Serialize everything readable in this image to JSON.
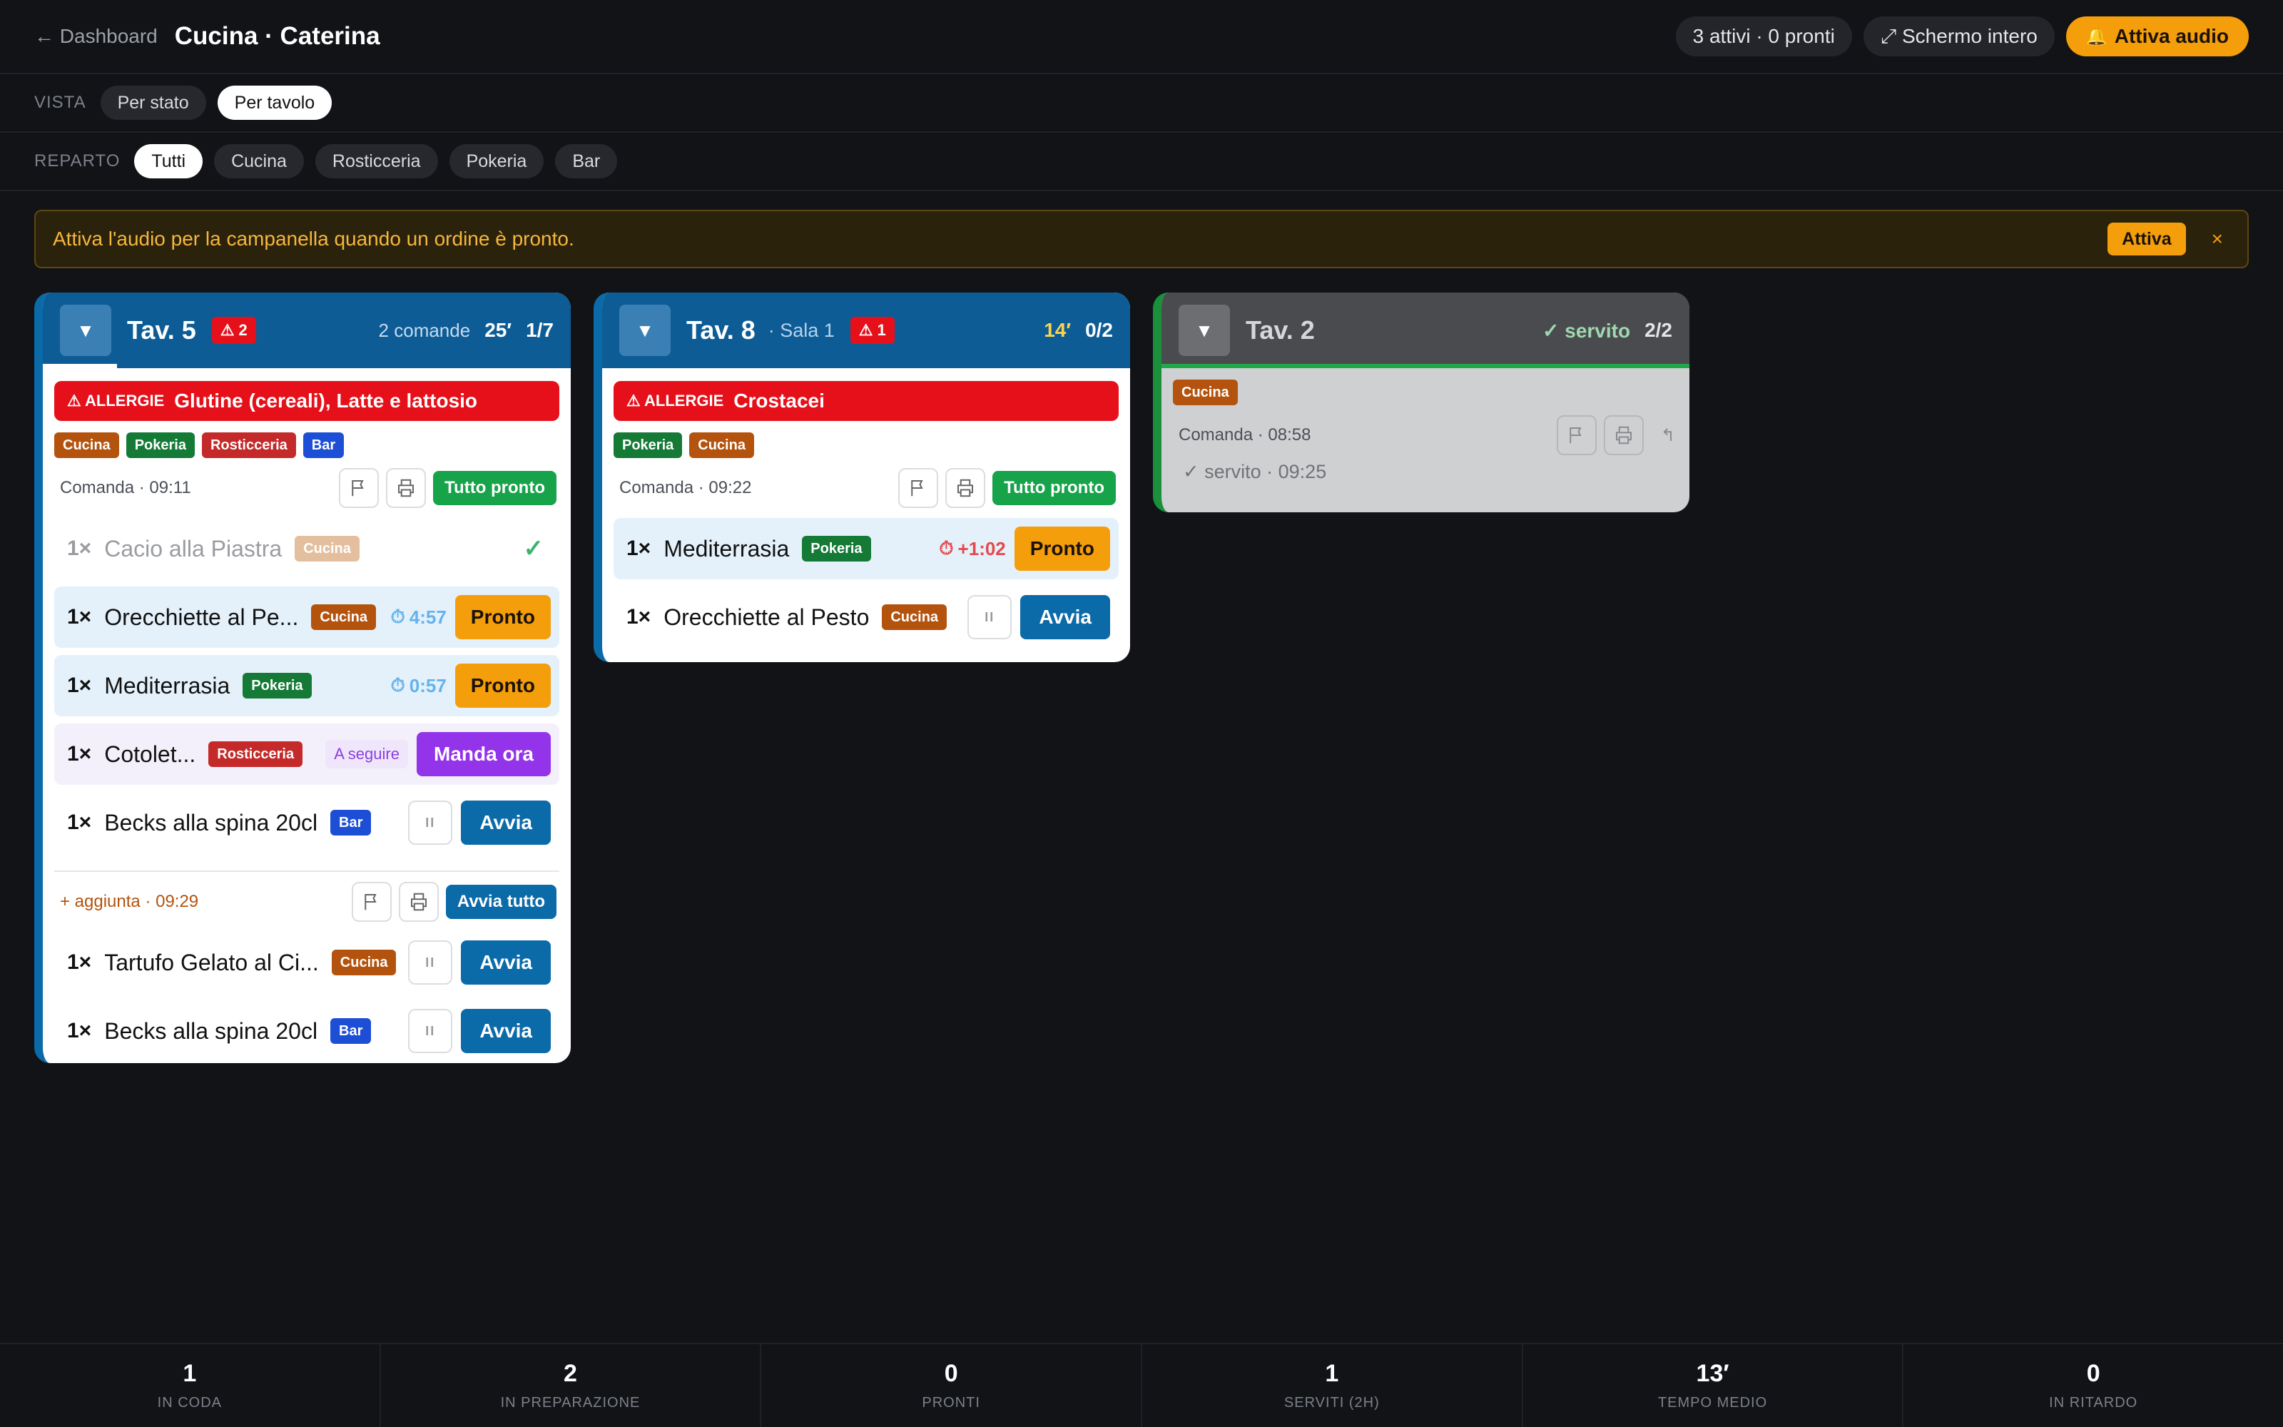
{
  "header": {
    "back": "← Dashboard",
    "title": "Cucina · Caterina",
    "status": "3 attivi · 0 pronti",
    "fullscreen": "⤢ Schermo intero",
    "audio": "Attiva audio"
  },
  "filters": {
    "vista_label": "VISTA",
    "vista": [
      "Per stato",
      "Per tavolo"
    ],
    "reparto_label": "REPARTO",
    "reparto": [
      "Tutti",
      "Cucina",
      "Rosticceria",
      "Pokeria",
      "Bar"
    ]
  },
  "banner": {
    "text": "Attiva l'audio per la campanella quando un ordine è pronto.",
    "button": "Attiva",
    "close": "×"
  },
  "tables": [
    {
      "name": "Tav. 5",
      "alerts": "2",
      "commands": "2 comande",
      "time": "25′",
      "count": "1/7",
      "progress": 0.14,
      "allergy_label": "ALLERGIE",
      "allergy": "Glutine (cereali), Latte e lattosio",
      "depts": [
        "Cucina",
        "Pokeria",
        "Rosticceria",
        "Bar"
      ],
      "cmd1": {
        "label": "Comanda · 09:11",
        "action": "Tutto pronto"
      },
      "items1": [
        {
          "qty": "1×",
          "name": "Cacio alla Piastra",
          "dept": "Cucina"
        },
        {
          "qty": "1×",
          "name": "Orecchiette al Pe...",
          "dept": "Cucina",
          "timer": "4:57",
          "action": "Pronto"
        },
        {
          "qty": "1×",
          "name": "Mediterrasia",
          "dept": "Pokeria",
          "timer": "0:57",
          "action": "Pronto"
        },
        {
          "qty": "1×",
          "name": "Cotolet...",
          "dept": "Rosticceria",
          "note": "A seguire",
          "action": "Manda ora"
        },
        {
          "qty": "1×",
          "name": "Becks alla spina 20cl",
          "dept": "Bar",
          "pause": "II",
          "action": "Avvia"
        }
      ],
      "cmd2": {
        "label": "+ aggiunta · 09:29",
        "action": "Avvia tutto"
      },
      "items2": [
        {
          "qty": "1×",
          "name": "Tartufo Gelato al Ci...",
          "dept": "Cucina",
          "pause": "II",
          "action": "Avvia"
        },
        {
          "qty": "1×",
          "name": "Becks alla spina 20cl",
          "dept": "Bar",
          "pause": "II",
          "action": "Avvia"
        }
      ]
    },
    {
      "name": "Tav. 8",
      "sala": "· Sala 1",
      "alerts": "1",
      "time": "14′",
      "count": "0/2",
      "allergy_label": "ALLERGIE",
      "allergy": "Crostacei",
      "depts": [
        "Pokeria",
        "Cucina"
      ],
      "cmd1": {
        "label": "Comanda · 09:22",
        "action": "Tutto pronto"
      },
      "items1": [
        {
          "qty": "1×",
          "name": "Mediterrasia",
          "dept": "Pokeria",
          "timer": "+1:02",
          "action": "Pronto"
        },
        {
          "qty": "1×",
          "name": "Orecchiette al Pesto",
          "dept": "Cucina",
          "pause": "II",
          "action": "Avvia"
        }
      ]
    },
    {
      "name": "Tav. 2",
      "served": "✓ servito",
      "count": "2/2",
      "depts": [
        "Cucina"
      ],
      "cmd1": {
        "label": "Comanda · 08:58",
        "extra": "↰"
      },
      "served_line": "✓ servito · 09:25"
    }
  ],
  "stats": [
    {
      "value": "1",
      "label": "IN CODA"
    },
    {
      "value": "2",
      "label": "IN PREPARAZIONE"
    },
    {
      "value": "0",
      "label": "PRONTI"
    },
    {
      "value": "1",
      "label": "SERVITI (2H)"
    },
    {
      "value": "13′",
      "label": "TEMPO MEDIO"
    },
    {
      "value": "0",
      "label": "IN RITARDO"
    }
  ],
  "colors": {
    "cucina": "#b4530e",
    "pokeria": "#157a36",
    "rosticceria": "#c42a2a",
    "bar": "#1d4fd6",
    "accent": "#f59e0b",
    "allergy": "#e5101a"
  }
}
